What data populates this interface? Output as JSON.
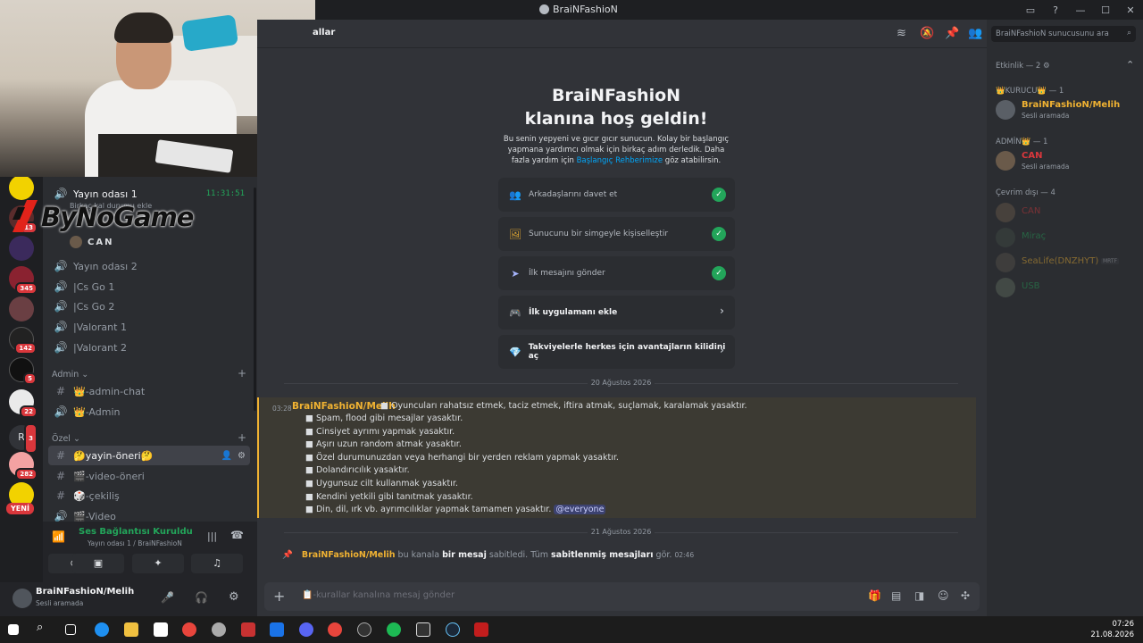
{
  "window": {
    "title": "BraiNFashioN"
  },
  "header": {
    "channel_fragment": "allar",
    "search_placeholder": "BraiNFashioN sunucusunu ara"
  },
  "overlay": {
    "logo_text": "ByNoGame"
  },
  "channels": {
    "voice_active": {
      "name": "Yayın odası 1",
      "timer": "11:31:51",
      "status": "Birkaç kal durumu ekle"
    },
    "voice_user": "CAN",
    "voice_list": [
      "Yayın odası 2",
      "|Cs Go 1",
      "|Cs Go 2",
      "|Valorant 1",
      "|Valorant 2"
    ],
    "admin_category": "Admin",
    "admin_channels": [
      {
        "label": "👑-admin-chat",
        "icon": "#"
      },
      {
        "label": "👑-Admin",
        "icon": "🔊"
      }
    ],
    "ozel_category": "Özel",
    "ozel_channels": [
      {
        "label": "🤔yayin-öneri🤔",
        "icon": "#"
      },
      {
        "label": "🎬-video-öneri",
        "icon": "#"
      },
      {
        "label": "🎲-çekiliş",
        "icon": "#"
      },
      {
        "label": "🎬-Video",
        "icon": "🔊"
      }
    ]
  },
  "servers": {
    "badges": [
      "13",
      "345",
      "142",
      "5",
      "22",
      "3",
      "282"
    ],
    "r_label": "R",
    "new_label": "YENİ"
  },
  "voice_panel": {
    "status": "Ses Bağlantısı Kuruldu",
    "location": "Yayın odası 1 / BraiNFashioN"
  },
  "user_panel": {
    "name": "BraiNFashioN/Melih",
    "status": "Sesli aramada"
  },
  "welcome": {
    "title_line1": "BraiNFashioN",
    "title_line2": "klanına hoş geldin!",
    "desc_part1": "Bu senin yepyeni ve gıcır gıcır sunucun. Kolay bir başlangıç yapmana yardımcı olmak için birkaç adım derledik. Daha fazla yardım için ",
    "desc_link": "Başlangıç Rehberimize",
    "desc_part2": " göz atabilirsin."
  },
  "tasks": [
    {
      "label": "Arkadaşlarını davet et",
      "done": true,
      "icon": "👥"
    },
    {
      "label": "Sunucunu bir simgeyle kişiselleştir",
      "done": true,
      "icon": "🖼"
    },
    {
      "label": "İlk mesajını gönder",
      "done": true,
      "icon": "➤"
    },
    {
      "label": "İlk uygulamanı ekle",
      "done": false,
      "icon": "🎮"
    },
    {
      "label": "Takviyelerle herkes için avantajların kilidini aç",
      "done": false,
      "icon": "💎"
    }
  ],
  "dates": [
    "20 Ağustos 2026",
    "21 Ağustos 2026"
  ],
  "message": {
    "time": "03:28",
    "author": "BraiNFashioN/Melih",
    "lines": [
      "■ Oyuncuları rahatsız etmek, taciz etmek, iftira atmak, suçlamak, karalamak yasaktır.",
      "■ Spam, flood gibi mesajlar yasaktır.",
      "■ Cinsiyet ayrımı yapmak yasaktır.",
      "■ Aşırı uzun random atmak yasaktır.",
      "■ Özel durumunuzdan veya herhangi bir yerden reklam yapmak yasaktır.",
      "■ Dolandırıcılık yasaktır.",
      "■ Uygunsuz cilt kullanmak yasaktır.",
      "■ Kendini yetkili gibi tanıtmak yasaktır.",
      "■ Din, dil, ırk vb. ayrımcılıklar yapmak tamamen yasaktır."
    ],
    "mention": "@everyone"
  },
  "system_message": {
    "author": "BraiNFashioN/Melih",
    "text1": " bu kanala ",
    "bold1": "bir mesaj",
    "text2": " sabitledi. Tüm ",
    "bold2": "sabitlenmiş mesajları",
    "text3": " gör.",
    "time": "02:46"
  },
  "composer": {
    "placeholder": "📋-kurallar kanalına mesaj gönder"
  },
  "members": {
    "activity_header": "Etkinlik — 2",
    "groups": [
      {
        "header": "👑KURUCU👑 — 1",
        "members": [
          {
            "name": "BraiNFashioN/Melih",
            "status": "Sesli aramada",
            "color": "#f0b232"
          }
        ]
      },
      {
        "header": "ADMİN👑 — 1",
        "members": [
          {
            "name": "CAN",
            "status": "Sesli aramada",
            "color": "#da373c"
          }
        ]
      }
    ],
    "offline_header": "Çevrim dışı — 4",
    "offline": [
      {
        "name": "CAN",
        "color": "#da373c",
        "tag": ""
      },
      {
        "name": "Miraç",
        "color": "#23a55a",
        "tag": ""
      },
      {
        "name": "SeaLife(DNZHYT)",
        "color": "#f0b232",
        "tag": "MRTF"
      },
      {
        "name": "USB",
        "color": "#23a55a",
        "tag": ""
      }
    ]
  },
  "taskbar": {
    "time": "07:26",
    "date": "21.08.2026"
  },
  "colors": {
    "accent": "#5865f2",
    "gold": "#f0b232",
    "online": "#23a55a",
    "danger": "#da373c"
  }
}
